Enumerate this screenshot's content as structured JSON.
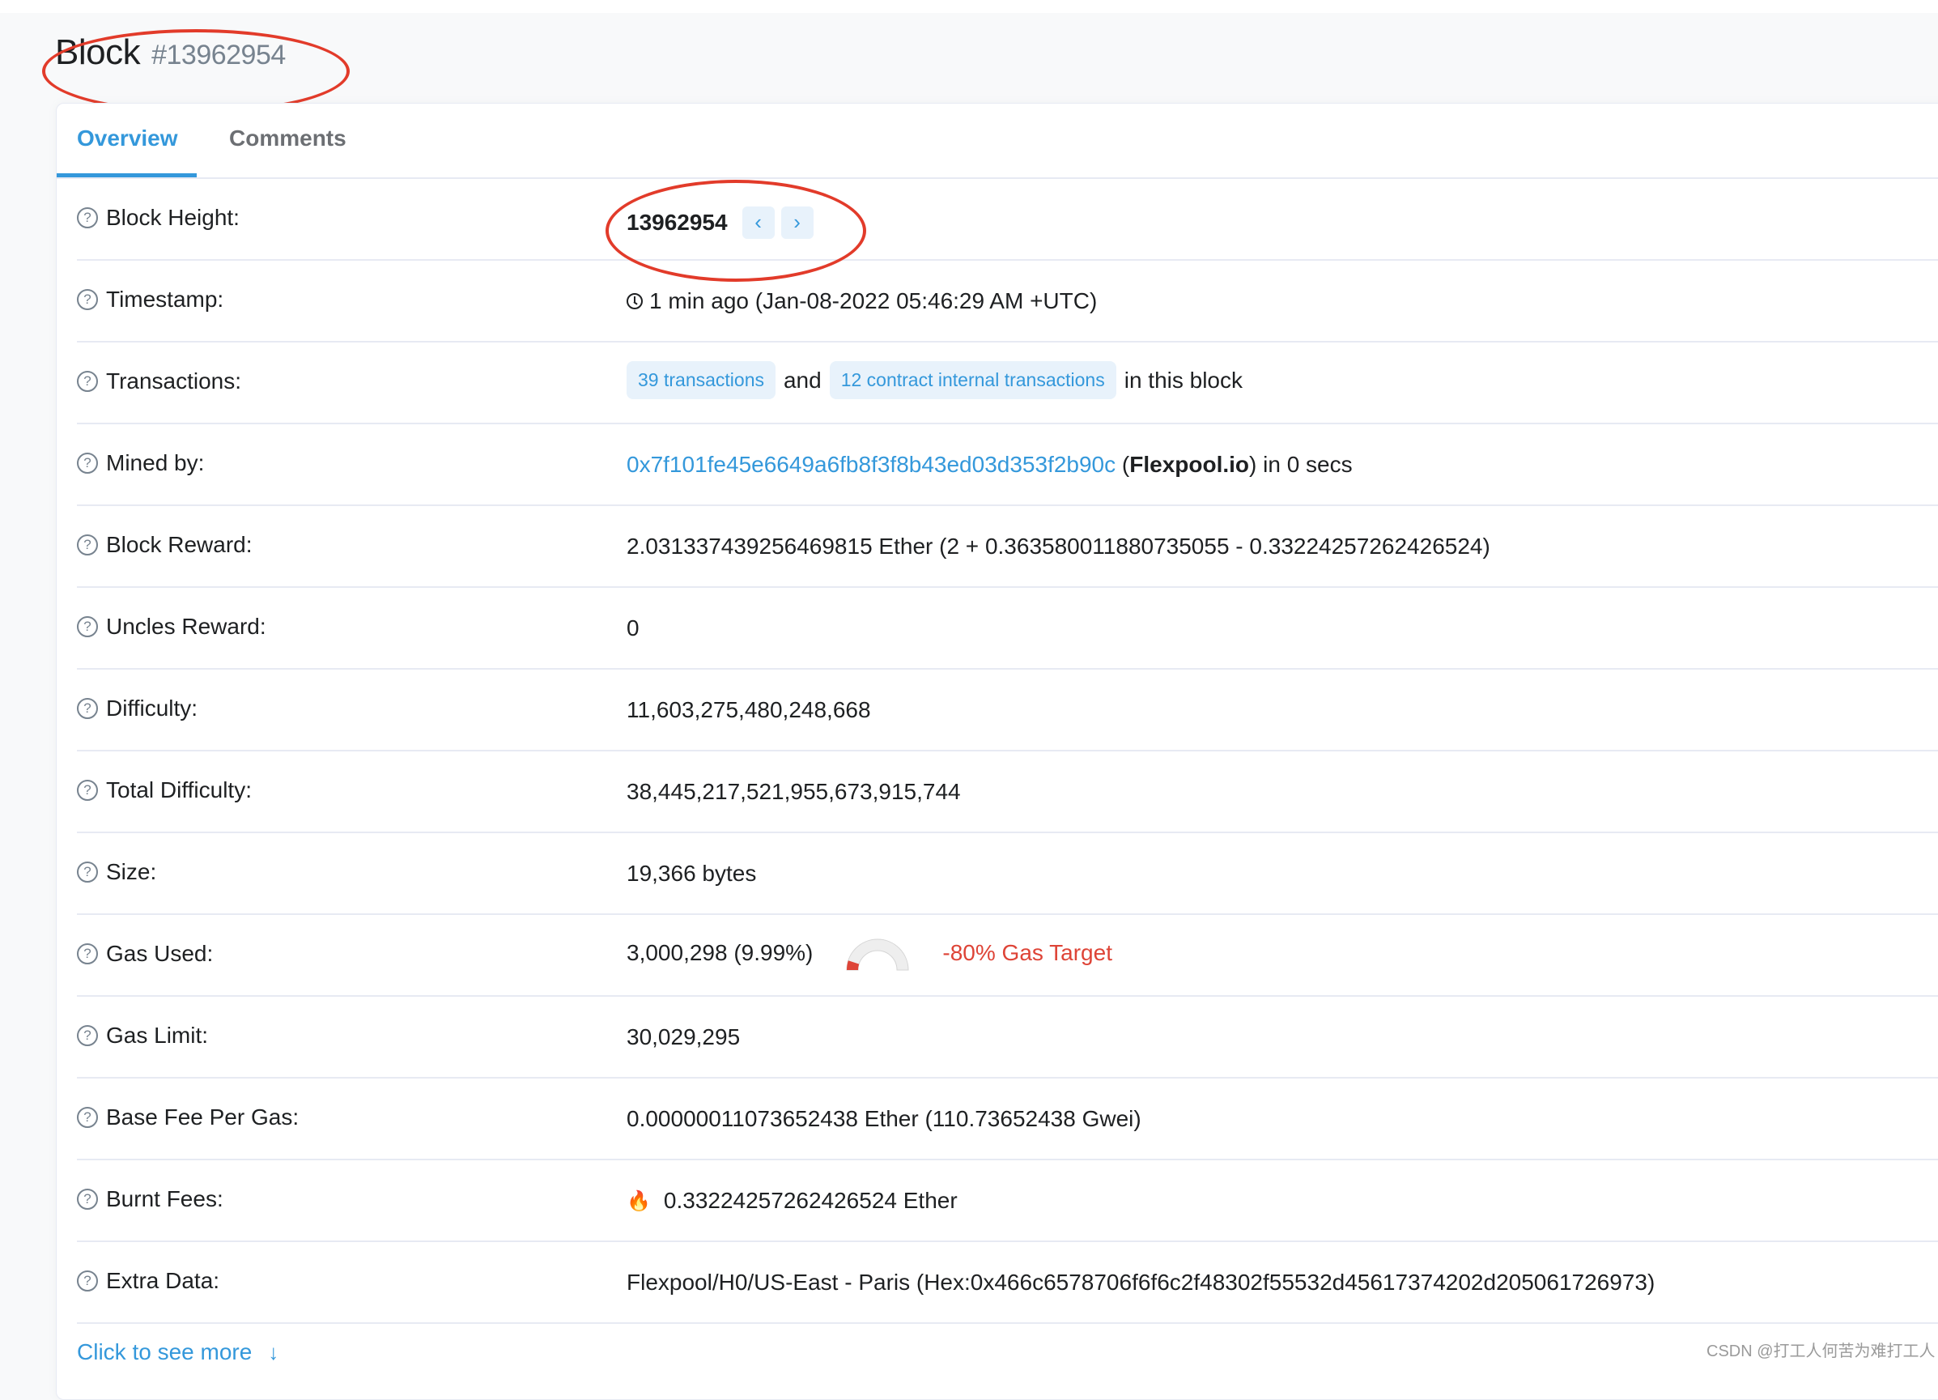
{
  "header": {
    "title": "Block",
    "block_number": "#13962954"
  },
  "tabs": [
    {
      "label": "Overview",
      "active": true
    },
    {
      "label": "Comments",
      "active": false
    }
  ],
  "rows": {
    "block_height": {
      "label": "Block Height:",
      "value": "13962954",
      "prev_icon": "chevron-left-icon",
      "next_icon": "chevron-right-icon"
    },
    "timestamp": {
      "label": "Timestamp:",
      "value": "1 min ago (Jan-08-2022 05:46:29 AM +UTC)",
      "icon": "clock-icon"
    },
    "transactions": {
      "label": "Transactions:",
      "tx_link": "39 transactions",
      "and_text": "and",
      "internal_link": "12 contract internal transactions",
      "suffix": "in this block"
    },
    "mined_by": {
      "label": "Mined by:",
      "address": "0x7f101fe45e6649a6fb8f3f8b43ed03d353f2b90c",
      "open_paren": "(",
      "pool": "Flexpool.io",
      "suffix": ") in 0 secs"
    },
    "block_reward": {
      "label": "Block Reward:",
      "value": "2.031337439256469815 Ether (2 + 0.363580011880735055 - 0.33224257262426524)"
    },
    "uncles_reward": {
      "label": "Uncles Reward:",
      "value": "0"
    },
    "difficulty": {
      "label": "Difficulty:",
      "value": "11,603,275,480,248,668"
    },
    "total_difficulty": {
      "label": "Total Difficulty:",
      "value": "38,445,217,521,955,673,915,744"
    },
    "size": {
      "label": "Size:",
      "value": "19,366 bytes"
    },
    "gas_used": {
      "label": "Gas Used:",
      "value": "3,000,298 (9.99%)",
      "gauge_fraction": 0.0999,
      "target_text": "-80% Gas Target"
    },
    "gas_limit": {
      "label": "Gas Limit:",
      "value": "30,029,295"
    },
    "base_fee": {
      "label": "Base Fee Per Gas:",
      "value": "0.00000011073652438 Ether (110.73652438 Gwei)"
    },
    "burnt_fees": {
      "label": "Burnt Fees:",
      "value": "0.33224257262426524 Ether",
      "icon": "fire-icon"
    },
    "extra_data": {
      "label": "Extra Data:",
      "value": "Flexpool/H0/US-East - Paris (Hex:0x466c6578706f6f6c2f48302f55532d45617374202d205061726973)"
    }
  },
  "see_more": {
    "label": "Click to see more",
    "arrow": "↓"
  },
  "watermark": "CSDN @打工人何苦为难打工人",
  "colors": {
    "accent": "#3498db",
    "danger": "#de4437",
    "annotation": "#e23b2a"
  }
}
